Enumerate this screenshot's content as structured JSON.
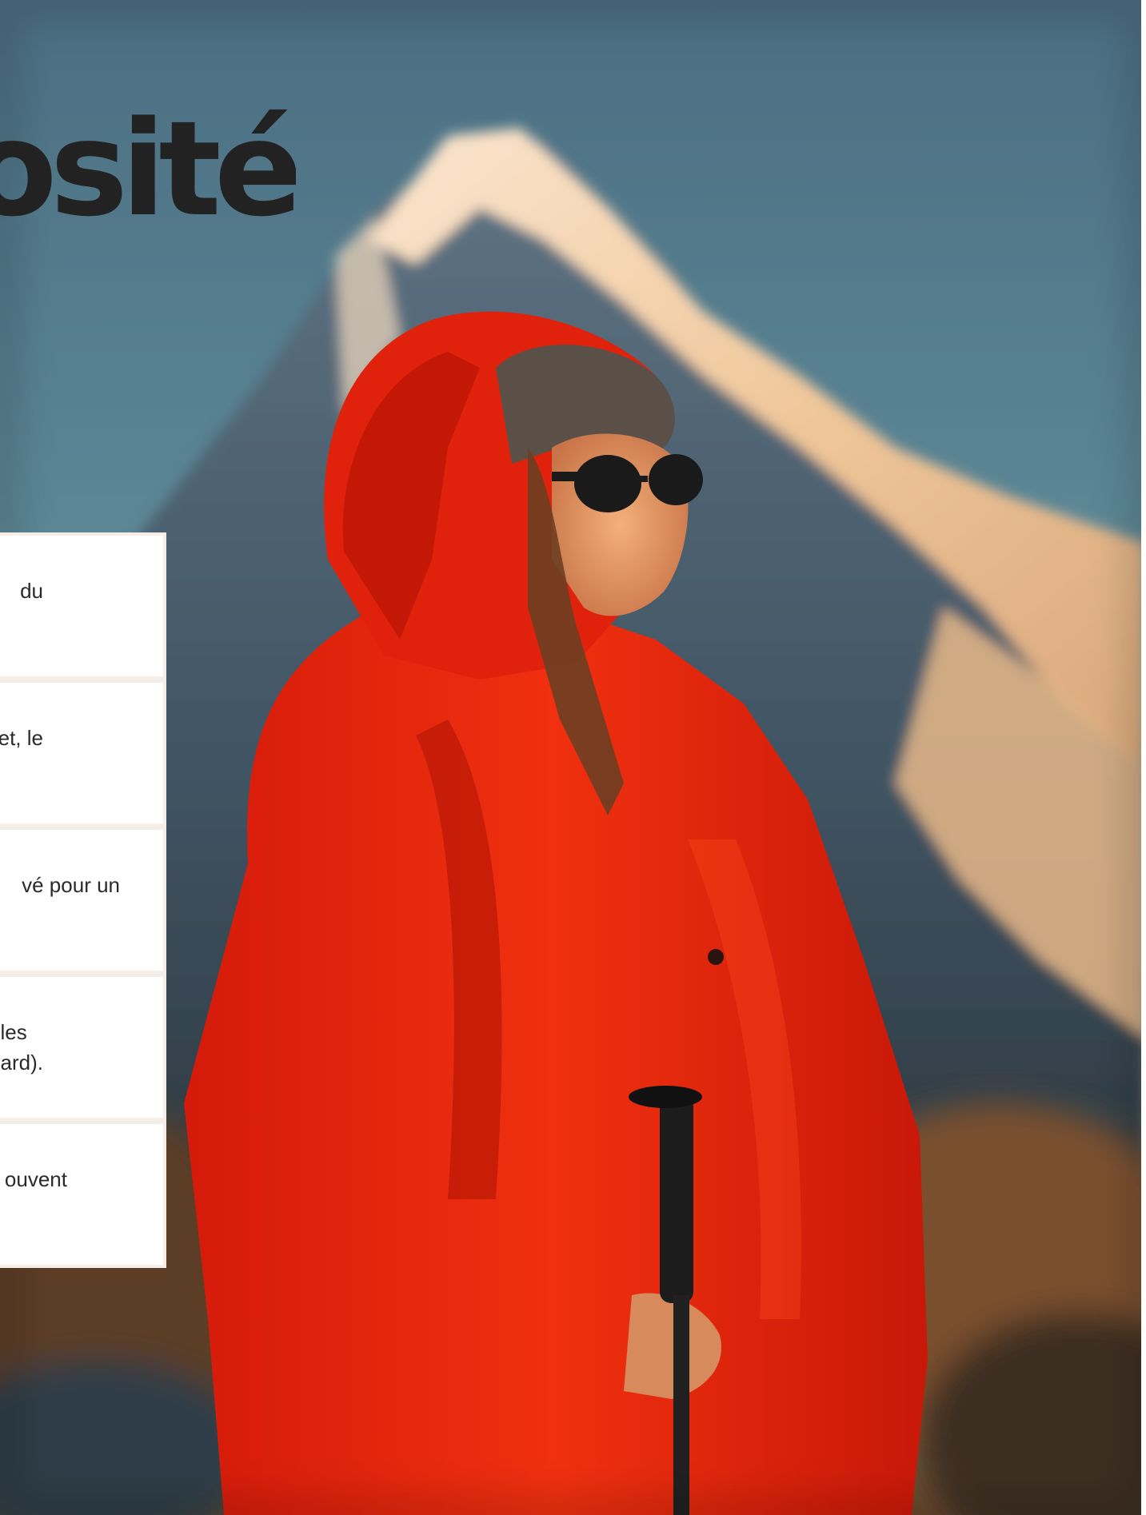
{
  "headline": "osité",
  "cards": [
    {
      "text": "du"
    },
    {
      "text": "et, le"
    },
    {
      "text": "vé pour un"
    },
    {
      "text": "les\nard)."
    },
    {
      "text": "ouvent"
    }
  ],
  "colors": {
    "headline": "#222222",
    "card_background": "#ffffff",
    "card_border": "#f5ede7",
    "sky_top": "#4d7083",
    "jacket_red": "#e2200f"
  },
  "image": {
    "subject": "hiker in red hooded parka with sunglasses and trekking pole",
    "background": "snow-covered mountain peak at sunset"
  }
}
